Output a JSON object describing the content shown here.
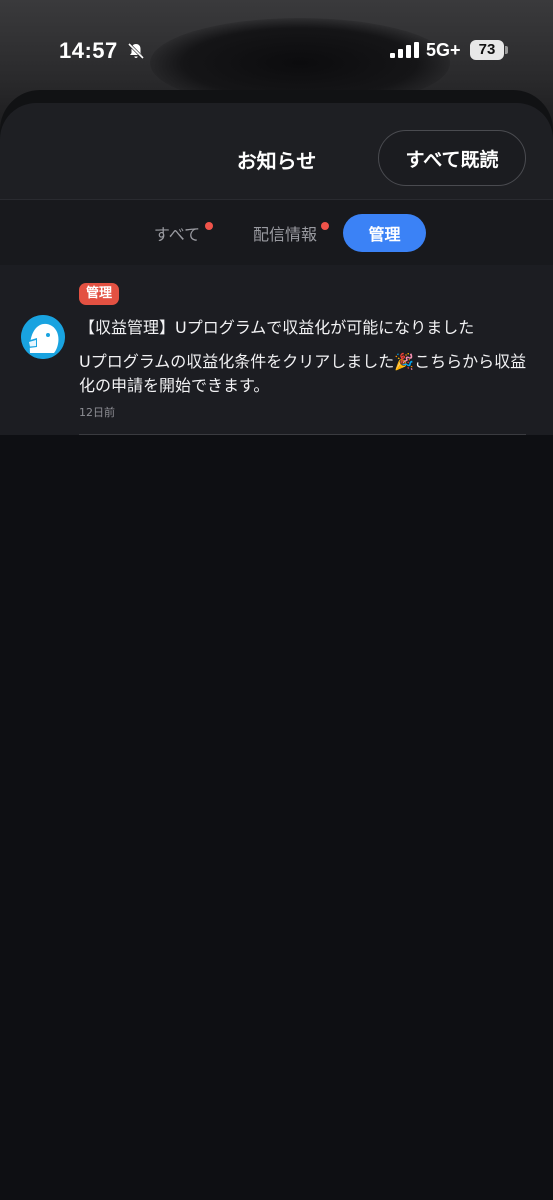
{
  "status_bar": {
    "time": "14:57",
    "network": "5G+",
    "battery": "73"
  },
  "header": {
    "title": "お知らせ",
    "mark_all_read": "すべて既読"
  },
  "tabs": [
    {
      "label": "すべて",
      "unread_dot": true,
      "active": false
    },
    {
      "label": "配信情報",
      "unread_dot": true,
      "active": false
    },
    {
      "label": "管理",
      "unread_dot": false,
      "active": true
    }
  ],
  "notifications": [
    {
      "category": "管理",
      "title": "【収益管理】Uプログラムで収益化が可能になりました",
      "body": "Uプログラムの収益化条件をクリアしました🎉こちらから収益化の申請を開始できます。",
      "time": "12日前"
    }
  ],
  "colors": {
    "accent": "#3b82f6",
    "badge": "#e35142",
    "dot": "#f0534a",
    "avatar": "#19a3e0"
  }
}
